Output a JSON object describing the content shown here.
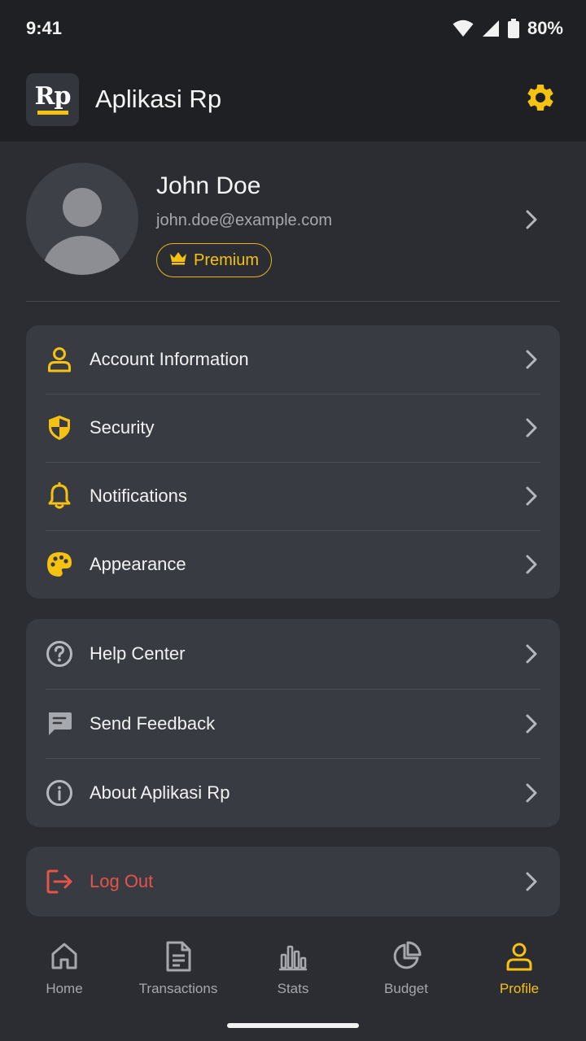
{
  "status_bar": {
    "time": "9:41",
    "battery": "80%"
  },
  "header": {
    "logo_text": "Rp",
    "title": "Aplikasi Rp",
    "settings_icon": "gear-icon"
  },
  "profile": {
    "name": "John Doe",
    "email": "john.doe@example.com",
    "badge": "Premium"
  },
  "settings_menu": [
    {
      "label": "Account Information",
      "icon": "user-icon"
    },
    {
      "label": "Security",
      "icon": "shield-icon"
    },
    {
      "label": "Notifications",
      "icon": "bell-icon"
    },
    {
      "label": "Appearance",
      "icon": "palette-icon"
    }
  ],
  "support_menu": [
    {
      "label": "Help Center",
      "icon": "help-circle-icon"
    },
    {
      "label": "Send Feedback",
      "icon": "feedback-icon"
    },
    {
      "label": "About Aplikasi Rp",
      "icon": "info-icon"
    }
  ],
  "logout": {
    "label": "Log Out",
    "icon": "logout-icon"
  },
  "bottom_nav": [
    {
      "label": "Home",
      "icon": "home-icon",
      "active": false
    },
    {
      "label": "Transactions",
      "icon": "document-icon",
      "active": false
    },
    {
      "label": "Stats",
      "icon": "bar-chart-icon",
      "active": false
    },
    {
      "label": "Budget",
      "icon": "pie-chart-icon",
      "active": false
    },
    {
      "label": "Profile",
      "icon": "user-icon",
      "active": true
    }
  ],
  "colors": {
    "accent": "#f5c211",
    "background": "#2b2d33",
    "card": "#383b42",
    "danger": "#e5534b"
  }
}
